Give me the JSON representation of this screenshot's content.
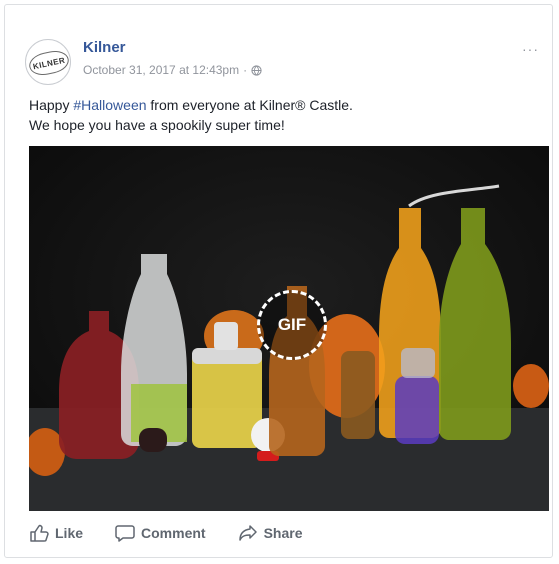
{
  "post": {
    "page_name": "Kilner",
    "avatar_text": "KILNER",
    "timestamp": "October 31, 2017 at 12:43pm",
    "separator": "·",
    "more_label": "···",
    "text": {
      "line1_prefix": "Happy ",
      "hashtag": "#Halloween",
      "line1_suffix": " from everyone at Kilner® Castle.",
      "line2": "We hope you have a spookily super time!"
    },
    "media": {
      "badge": "GIF",
      "background_color": "#121212"
    }
  },
  "actions": {
    "like": "Like",
    "comment": "Comment",
    "share": "Share"
  },
  "colors": {
    "link": "#365899",
    "meta": "#90949c",
    "action": "#606770"
  }
}
